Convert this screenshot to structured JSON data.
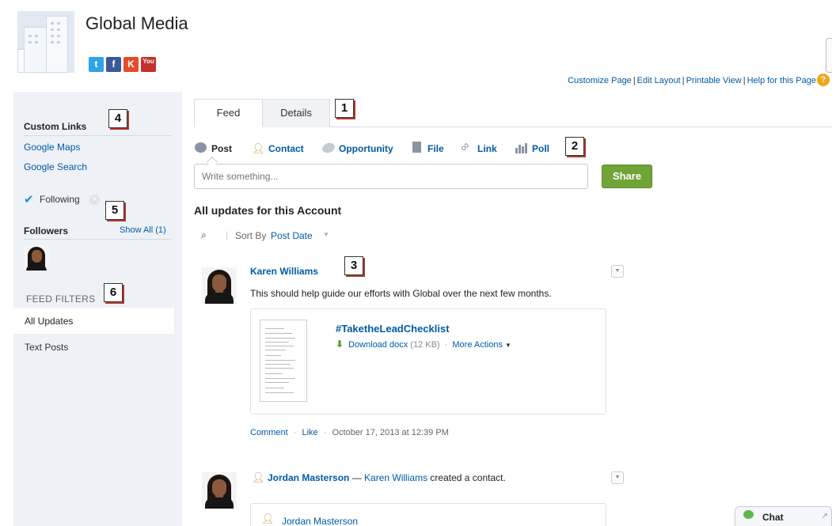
{
  "header": {
    "title": "Global Media",
    "social": [
      {
        "icon": "twitter-icon",
        "glyph": "t",
        "color": "#2fa3e6"
      },
      {
        "icon": "facebook-icon",
        "glyph": "f",
        "color": "#3b5998"
      },
      {
        "icon": "klout-icon",
        "glyph": "K",
        "color": "#e44c29"
      },
      {
        "icon": "youtube-icon",
        "glyph": "You",
        "color": "#c4302b"
      }
    ],
    "links": [
      "Customize Page",
      "Edit Layout",
      "Printable View",
      "Help for this Page"
    ]
  },
  "sidebar": {
    "custom_links_heading": "Custom Links",
    "custom_links": [
      "Google Maps",
      "Google Search"
    ],
    "following_label": "Following",
    "followers_heading": "Followers",
    "show_all": "Show All (1)",
    "feed_filters_heading": "FEED FILTERS",
    "filters": [
      "All Updates",
      "Text Posts"
    ]
  },
  "callouts": [
    "1",
    "2",
    "3",
    "4",
    "5",
    "6"
  ],
  "tabs": [
    "Feed",
    "Details"
  ],
  "publisher": {
    "actions": [
      {
        "label": "Post",
        "icon": "post-bubble-icon"
      },
      {
        "label": "Contact",
        "icon": "contact-icon"
      },
      {
        "label": "Opportunity",
        "icon": "opportunity-icon"
      },
      {
        "label": "File",
        "icon": "file-icon"
      },
      {
        "label": "Link",
        "icon": "link-icon"
      },
      {
        "label": "Poll",
        "icon": "poll-icon"
      }
    ],
    "placeholder": "Write something...",
    "share_label": "Share"
  },
  "feed": {
    "heading": "All updates for this Account",
    "sort_by": "Sort By",
    "sort_value": "Post Date",
    "post1": {
      "author": "Karen Williams",
      "text": "This should help guide our efforts with Global over the next few months.",
      "file_name": "#TaketheLeadChecklist",
      "download_label": "Download docx",
      "file_size": "(12 KB)",
      "more_actions": "More Actions",
      "comment": "Comment",
      "like": "Like",
      "timestamp": "October 17, 2013 at 12:39 PM"
    },
    "post2": {
      "author": "Jordan Masterson",
      "dash": "—",
      "actor": "Karen Williams",
      "action_text": "created a contact.",
      "record_name": "Jordan Masterson"
    }
  },
  "chat": {
    "label": "Chat"
  }
}
